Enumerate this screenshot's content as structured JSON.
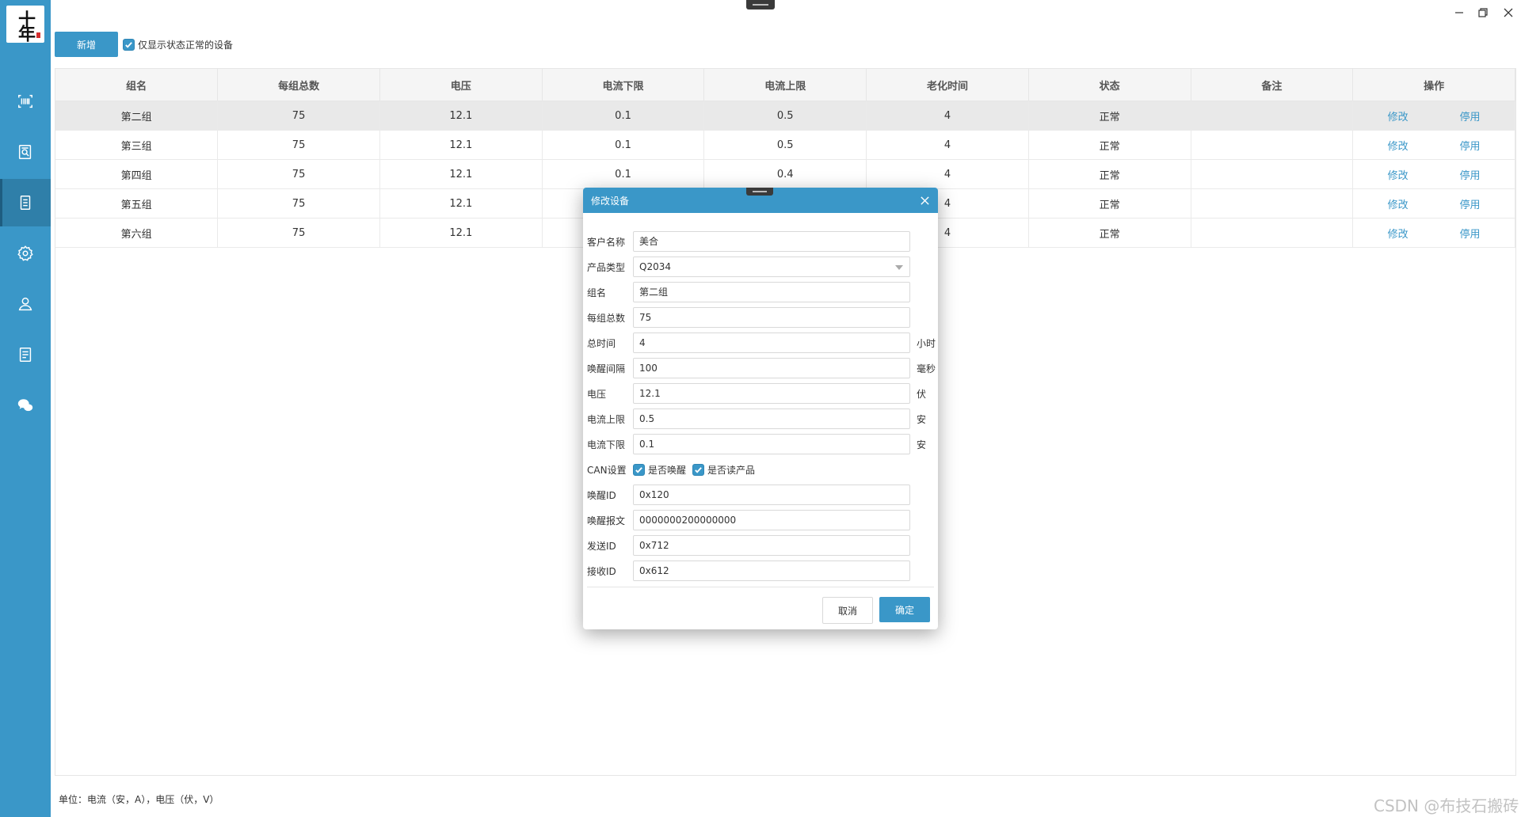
{
  "logo": {
    "text": "十年"
  },
  "sidebar": {
    "items": [
      {
        "icon": "barcode-icon"
      },
      {
        "icon": "report-search-icon"
      },
      {
        "icon": "device-list-icon",
        "active": true
      },
      {
        "icon": "gear-icon"
      },
      {
        "icon": "user-icon"
      },
      {
        "icon": "document-icon"
      },
      {
        "icon": "wechat-icon"
      }
    ]
  },
  "toolbar": {
    "add_label": "新增",
    "filter_label": "仅显示状态正常的设备",
    "filter_checked": true
  },
  "table": {
    "columns": [
      "组名",
      "每组总数",
      "电压",
      "电流下限",
      "电流上限",
      "老化时间",
      "状态",
      "备注",
      "操作"
    ],
    "rows": [
      {
        "group": "第二组",
        "total": "75",
        "voltage": "12.1",
        "current_min": "0.1",
        "current_max": "0.5",
        "aging": "4",
        "status": "正常",
        "note": "",
        "edit": "修改",
        "disable": "停用"
      },
      {
        "group": "第三组",
        "total": "75",
        "voltage": "12.1",
        "current_min": "0.1",
        "current_max": "0.5",
        "aging": "4",
        "status": "正常",
        "note": "",
        "edit": "修改",
        "disable": "停用"
      },
      {
        "group": "第四组",
        "total": "75",
        "voltage": "12.1",
        "current_min": "0.1",
        "current_max": "0.4",
        "aging": "4",
        "status": "正常",
        "note": "",
        "edit": "修改",
        "disable": "停用"
      },
      {
        "group": "第五组",
        "total": "75",
        "voltage": "12.1",
        "current_min": "",
        "current_max": "",
        "aging": "4",
        "status": "正常",
        "note": "",
        "edit": "修改",
        "disable": "停用"
      },
      {
        "group": "第六组",
        "total": "75",
        "voltage": "12.1",
        "current_min": "",
        "current_max": "",
        "aging": "4",
        "status": "正常",
        "note": "",
        "edit": "修改",
        "disable": "停用"
      }
    ]
  },
  "footer": {
    "note": "单位：电流（安，A），电压（伏，V）"
  },
  "dialog": {
    "title": "修改设备",
    "fields": {
      "customer": {
        "label": "客户名称",
        "value": "美合"
      },
      "product_type": {
        "label": "产品类型",
        "value": "Q2034"
      },
      "group_name": {
        "label": "组名",
        "value": "第二组"
      },
      "group_total": {
        "label": "每组总数",
        "value": "75"
      },
      "total_time": {
        "label": "总时间",
        "value": "4",
        "unit": "小时"
      },
      "wake_interval": {
        "label": "唤醒间隔",
        "value": "100",
        "unit": "毫秒"
      },
      "voltage": {
        "label": "电压",
        "value": "12.1",
        "unit": "伏"
      },
      "current_max": {
        "label": "电流上限",
        "value": "0.5",
        "unit": "安"
      },
      "current_min": {
        "label": "电流下限",
        "value": "0.1",
        "unit": "安"
      },
      "wake_id": {
        "label": "唤醒ID",
        "value": "0x120"
      },
      "wake_msg": {
        "label": "唤醒报文",
        "value": "0000000200000000"
      },
      "send_id": {
        "label": "发送ID",
        "value": "0x712"
      },
      "recv_id": {
        "label": "接收ID",
        "value": "0x612"
      }
    },
    "can": {
      "label": "CAN设置",
      "wake_label": "是否唤醒",
      "wake_checked": true,
      "read_label": "是否读产品",
      "read_checked": true
    },
    "cancel_label": "取消",
    "ok_label": "确定"
  },
  "watermark": "CSDN @布技石搬砖",
  "colors": {
    "accent": "#3a97c8",
    "sidebar": "#3a97c8",
    "link": "#3a97c8"
  }
}
